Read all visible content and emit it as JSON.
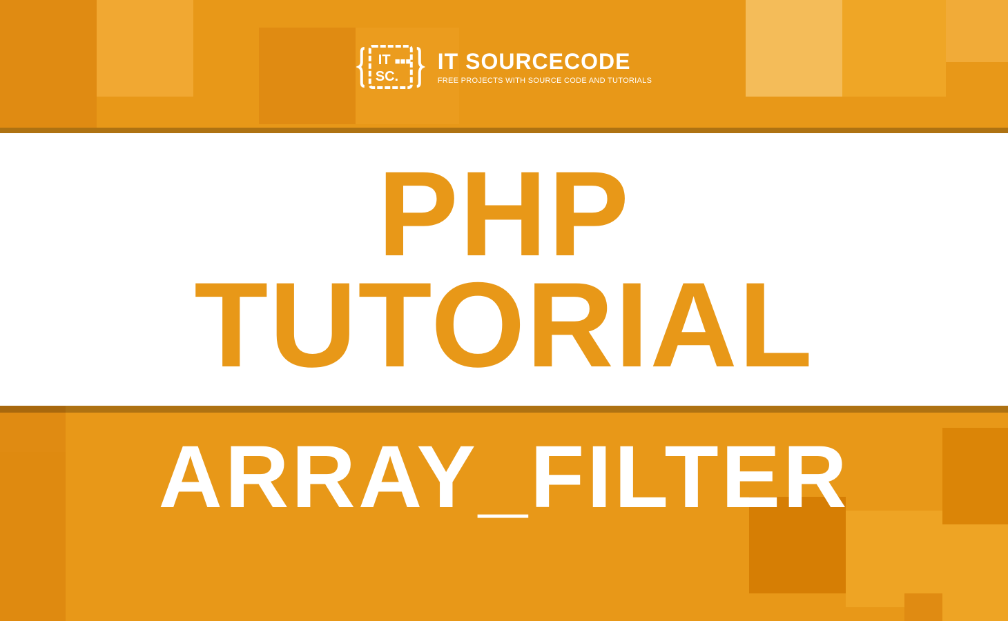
{
  "logo": {
    "title": "IT SOURCECODE",
    "subtitle": "FREE PROJECTS WITH SOURCE CODE AND TUTORIALS"
  },
  "heading": {
    "line1": "PHP",
    "line2": "TUTORIAL"
  },
  "function_name": "ARRAY_FILTER"
}
